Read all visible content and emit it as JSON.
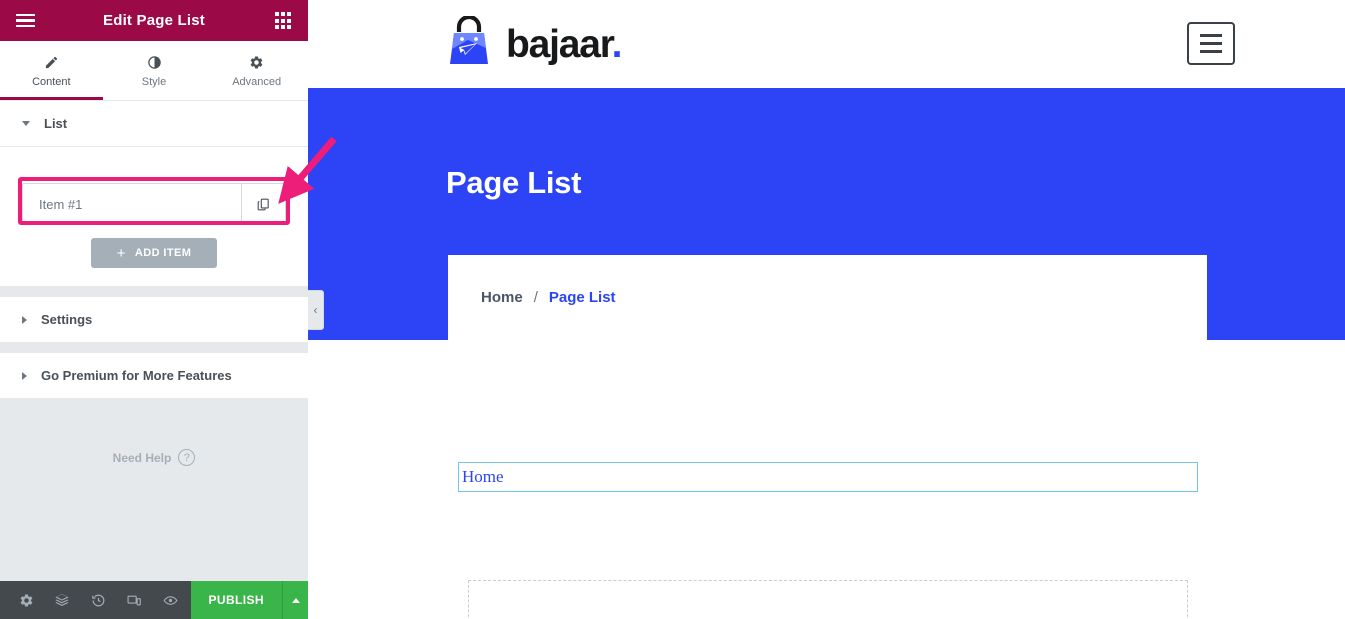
{
  "panel": {
    "header": {
      "title": "Edit Page List",
      "menu_icon": "hamburger-icon",
      "widgets_icon": "grid-apps-icon"
    },
    "tabs": [
      {
        "label": "Content",
        "icon": "pencil-icon",
        "active": true
      },
      {
        "label": "Style",
        "icon": "contrast-icon",
        "active": false
      },
      {
        "label": "Advanced",
        "icon": "gear-icon",
        "active": false
      }
    ],
    "sections": [
      {
        "label": "List",
        "expanded": true
      },
      {
        "label": "Settings",
        "expanded": false
      },
      {
        "label": "Go Premium for More Features",
        "expanded": false
      }
    ],
    "list_section": {
      "items": [
        {
          "label": "Item #1",
          "duplicate_icon": "copy-icon",
          "highlighted": true
        }
      ],
      "add_item_label": "ADD ITEM",
      "add_item_plus": "+"
    },
    "need_help": {
      "label": "Need Help",
      "icon": "question-mark-icon",
      "icon_glyph": "?"
    },
    "footer": {
      "icons": [
        "gear-settings-icon",
        "layers-navigator-icon",
        "history-revisions-icon",
        "responsive-mode-icon",
        "preview-eye-icon"
      ],
      "publish_label": "PUBLISH",
      "publish_caret_icon": "caret-up-icon",
      "publish_color": "#39b54a"
    },
    "collapse_handle": {
      "icon": "chevron-left-icon",
      "glyph": "‹"
    },
    "colors": {
      "header_bg": "#9b0a46",
      "panel_bg": "#e6e9ec",
      "footer_bg": "#44494d",
      "accent_highlight": "#ec1e79"
    }
  },
  "canvas": {
    "site_header": {
      "brand_name": "bajaar",
      "brand_dot": ".",
      "logo_icon": "shopping-bag-cursor-logo",
      "menu_toggle_icon": "hamburger-icon"
    },
    "hero": {
      "title": "Page List",
      "bg_color": "#2c44f5"
    },
    "breadcrumb": {
      "home": "Home",
      "separator": "/",
      "current": "Page List"
    },
    "widget": {
      "link_text": "Home",
      "link_color": "#2c44f5"
    }
  },
  "annotation": {
    "highlight_color": "#ec1e79",
    "arrow_icon": "pink-arrow-pointer"
  }
}
